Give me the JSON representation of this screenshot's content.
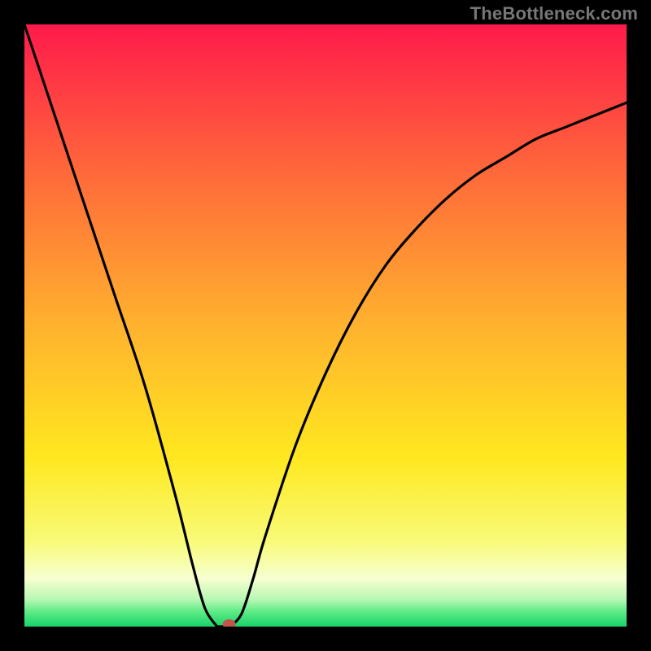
{
  "watermark": "TheBottleneck.com",
  "chart_data": {
    "type": "line",
    "title": "",
    "xlabel": "",
    "ylabel": "",
    "xlim": [
      0,
      100
    ],
    "ylim": [
      0,
      100
    ],
    "series": [
      {
        "name": "bottleneck-curve",
        "x": [
          0,
          5,
          10,
          15,
          20,
          25,
          28,
          30,
          32,
          33,
          34,
          36,
          38,
          40,
          45,
          50,
          55,
          60,
          65,
          70,
          75,
          80,
          85,
          90,
          95,
          100
        ],
        "y": [
          100,
          85,
          70,
          55,
          40,
          22,
          10,
          3,
          0,
          0,
          0,
          2,
          8,
          15,
          30,
          42,
          52,
          60,
          66,
          71,
          75,
          78,
          81,
          83,
          85,
          87
        ]
      }
    ],
    "flat_segment": {
      "x_start": 32,
      "x_end": 34,
      "y": 0
    },
    "marker": {
      "x": 34,
      "y": 0,
      "color": "#c2554a"
    },
    "background_gradient": {
      "stops": [
        {
          "offset": 0.0,
          "color": "#ff1a4b"
        },
        {
          "offset": 0.25,
          "color": "#ff6a3a"
        },
        {
          "offset": 0.5,
          "color": "#ffb22e"
        },
        {
          "offset": 0.72,
          "color": "#ffe81f"
        },
        {
          "offset": 0.86,
          "color": "#f8fb7a"
        },
        {
          "offset": 0.92,
          "color": "#f7ffd0"
        },
        {
          "offset": 0.955,
          "color": "#b8f7b3"
        },
        {
          "offset": 0.975,
          "color": "#5feb86"
        },
        {
          "offset": 1.0,
          "color": "#18d36a"
        }
      ]
    }
  }
}
